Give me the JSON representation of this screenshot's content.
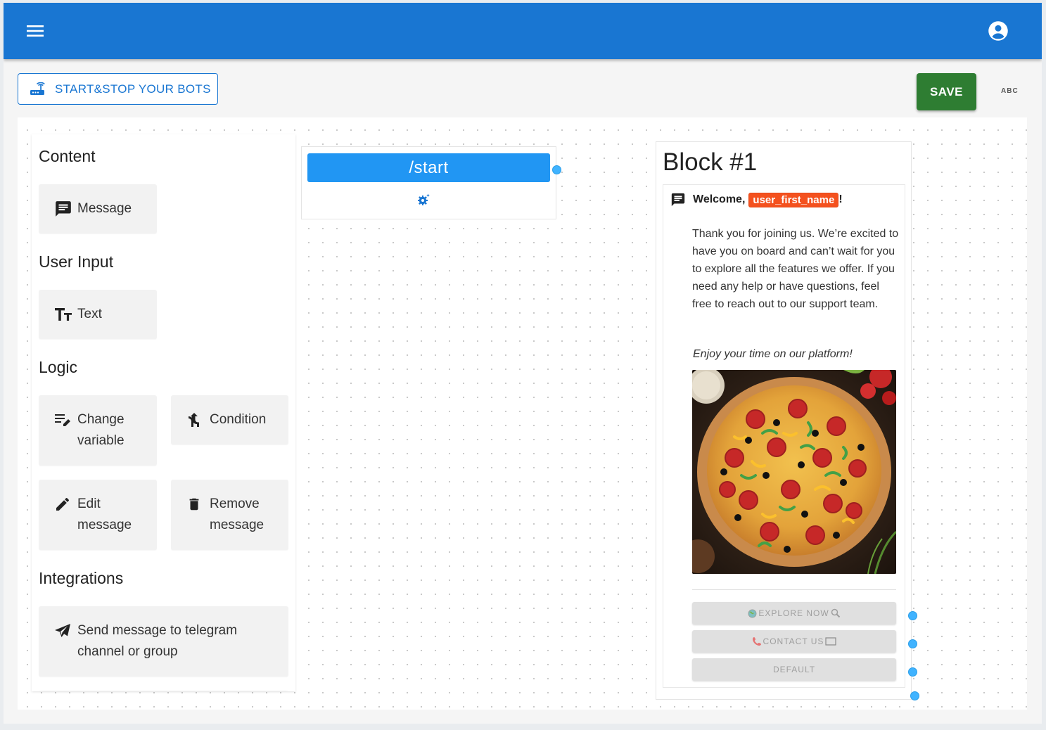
{
  "header": {
    "menu_icon": "menu-icon",
    "account_icon": "account-circle-icon",
    "bar_color": "#1976d2"
  },
  "toolbar": {
    "start_stop_label": "START&STOP YOUR BOTS",
    "start_stop_icon": "router-icon",
    "save_label": "SAVE",
    "save_color": "#2e7d32",
    "spellcheck_label": "ABC"
  },
  "palette": {
    "sections": [
      {
        "title": "Content",
        "items": [
          {
            "label": "Message",
            "icon": "message-icon"
          }
        ]
      },
      {
        "title": "User Input",
        "items": [
          {
            "label": "Text",
            "icon": "text-fields-icon"
          }
        ]
      },
      {
        "title": "Logic",
        "items": [
          {
            "label": "Change variable",
            "icon": "edit-note-icon"
          },
          {
            "label": "Condition",
            "icon": "fork-icon"
          },
          {
            "label": "Edit message",
            "icon": "pencil-icon"
          },
          {
            "label": "Remove message",
            "icon": "trash-icon"
          }
        ]
      },
      {
        "title": "Integrations",
        "items": [
          {
            "label": "Send message to telegram channel or group",
            "icon": "send-icon"
          }
        ]
      }
    ]
  },
  "start_node": {
    "command": "/start",
    "settings_icon": "gear-icon",
    "color": "#2196f3"
  },
  "block": {
    "title": "Block #1",
    "message": {
      "icon": "message-icon",
      "greeting": "Welcome,",
      "variable": "user_first_name",
      "greeting_end": "!",
      "body": "Thank you for joining us. We’re excited to have you on board and can’t wait for you to explore all the features we offer. If you need any help or have questions, feel free to reach out to our support team.",
      "closing": "Enjoy your time on our platform!",
      "image": "pizza-photo",
      "buttons": [
        {
          "label": "EXPLORE NOW",
          "prefix_icon": "globe-icon",
          "suffix_icon": "magnifier-icon"
        },
        {
          "label": "CONTACT US",
          "prefix_icon": "telephone-icon",
          "suffix_icon": "envelope-icon"
        },
        {
          "label": "DEFAULT"
        }
      ]
    }
  },
  "colors": {
    "connector": "#40b3ff",
    "variable_chip": "#f4511e"
  }
}
